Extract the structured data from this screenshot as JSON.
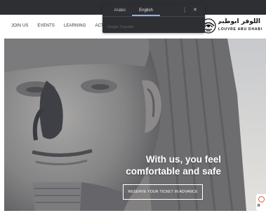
{
  "translate_popup": {
    "tabs": [
      "Arabic",
      "English"
    ],
    "active_tab": "English",
    "menu_icon": "more-vert-icon",
    "close_icon": "close-icon",
    "brand": "Google Translate",
    "accent_color": "#8ab4f8"
  },
  "nav": {
    "items": [
      "JOIN US",
      "EVENTS",
      "LEARNING",
      "ACTIV"
    ]
  },
  "logo": {
    "arabic": "اللوفر أبوظبي",
    "english": "LOUVRE ABU DHABI"
  },
  "hero": {
    "title_line1": "With us, you feel",
    "title_line2": "comfortable and safe",
    "cta_label": "RESERVE YOUR TICKET IN ADVANCE"
  },
  "side_widget": {
    "icon": "help-circle-icon",
    "label": "R"
  }
}
